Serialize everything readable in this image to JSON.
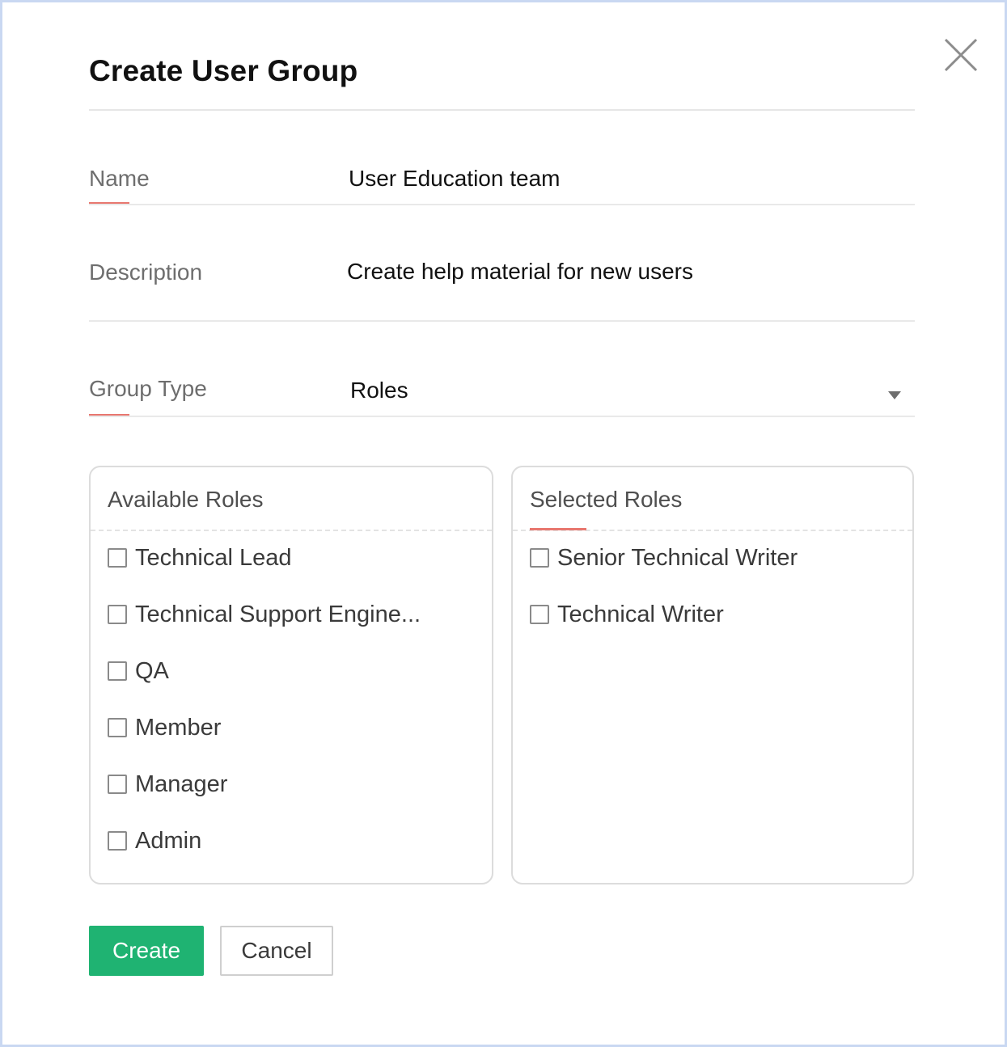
{
  "dialog": {
    "title": "Create User Group",
    "close_icon": "close-icon"
  },
  "form": {
    "name": {
      "label": "Name",
      "value": "User Education team"
    },
    "description": {
      "label": "Description",
      "value": "Create help material for new users"
    },
    "group_type": {
      "label": "Group Type",
      "value": "Roles",
      "caret_icon": "caret-down-icon"
    }
  },
  "available_roles": {
    "title": "Available Roles",
    "items": [
      {
        "label": "Technical Lead",
        "checked": false
      },
      {
        "label": "Technical Support Engine...",
        "checked": false
      },
      {
        "label": "QA",
        "checked": false
      },
      {
        "label": "Member",
        "checked": false
      },
      {
        "label": "Manager",
        "checked": false
      },
      {
        "label": "Admin",
        "checked": false
      }
    ]
  },
  "selected_roles": {
    "title": "Selected Roles",
    "items": [
      {
        "label": "Senior Technical Writer",
        "checked": false
      },
      {
        "label": "Technical Writer",
        "checked": false
      }
    ]
  },
  "actions": {
    "create_label": "Create",
    "cancel_label": "Cancel"
  },
  "colors": {
    "accent": "#e8776f",
    "primary_button": "#1fb372",
    "dialog_border": "#c9d8f2"
  }
}
